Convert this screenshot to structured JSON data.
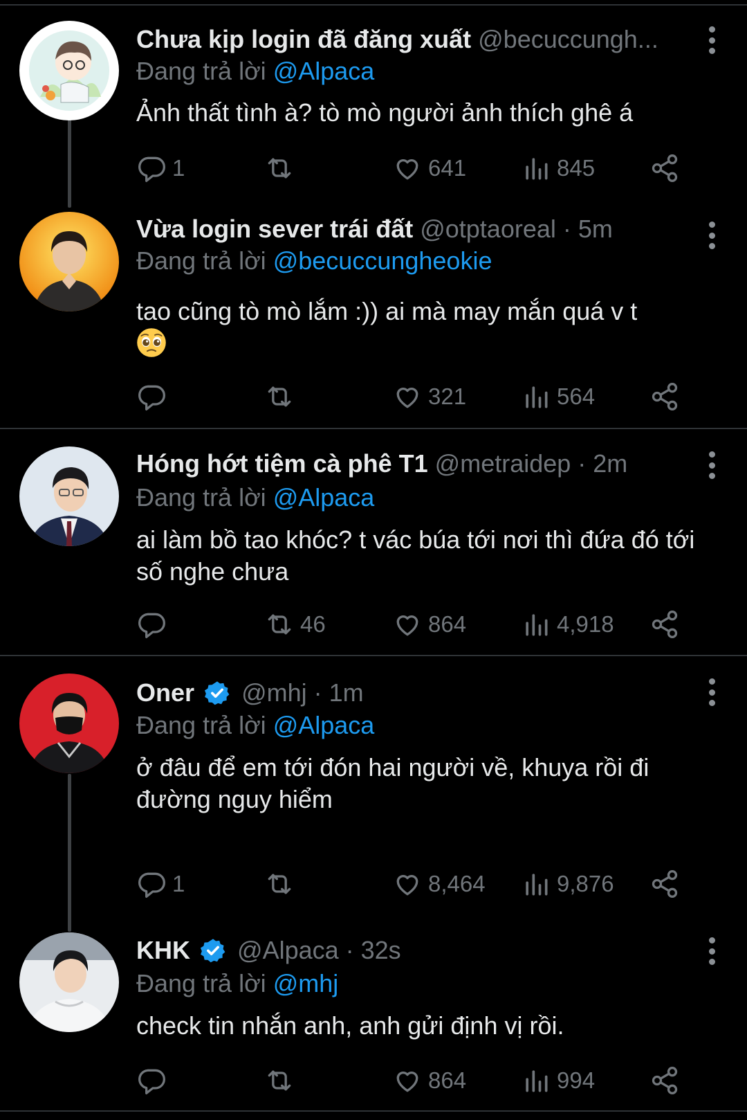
{
  "reply_prefix": "Đang trả lời",
  "tweets": [
    {
      "name": "Chưa kịp login đã đăng xuất",
      "handle": "@becuccungh...",
      "time": "",
      "replying_to": "@Alpaca",
      "text": "Ảnh thất tình à? tò mò người ảnh thích ghê á",
      "replies": "1",
      "retweets": "",
      "likes": "641",
      "views": "845"
    },
    {
      "name": "Vừa login sever trái đất",
      "handle": "@otptaoreal · 5m",
      "time": "",
      "replying_to": "@becuccungheokie",
      "text": "tao cũng tò mò lắm :)) ai mà may mắn quá v t",
      "emoji": "pleading-face",
      "replies": "",
      "retweets": "",
      "likes": "321",
      "views": "564"
    },
    {
      "name": "Hóng hớt tiệm cà phê T1",
      "handle": "@metraidep · 2m",
      "replying_to": "@Alpaca",
      "text": "ai làm bồ tao khóc? t vác búa tới nơi thì đứa đó tới số nghe chưa",
      "replies": "",
      "retweets": "46",
      "likes": "864",
      "views": "4,918"
    },
    {
      "name": "Oner",
      "verified": true,
      "handle": "@mhj · 1m",
      "replying_to": "@Alpaca",
      "text": "ở đâu để em tới đón hai người về, khuya rồi đi đường nguy hiểm",
      "replies": "1",
      "retweets": "",
      "likes": "8,464",
      "views": "9,876"
    },
    {
      "name": "KHK",
      "verified": true,
      "handle": "@Alpaca · 32s",
      "replying_to": "@mhj",
      "text": "check tin nhắn anh, anh gửi định vị rồi.",
      "replies": "",
      "retweets": "",
      "likes": "864",
      "views": "994"
    }
  ],
  "colors": {
    "background": "#000000",
    "text": "#e7e9ea",
    "secondary": "#71767b",
    "link": "#1d9bf0",
    "separator": "#2f3336"
  },
  "icons": [
    "reply-icon",
    "retweet-icon",
    "like-icon",
    "views-icon",
    "share-icon",
    "more-icon",
    "verified-badge-icon"
  ]
}
